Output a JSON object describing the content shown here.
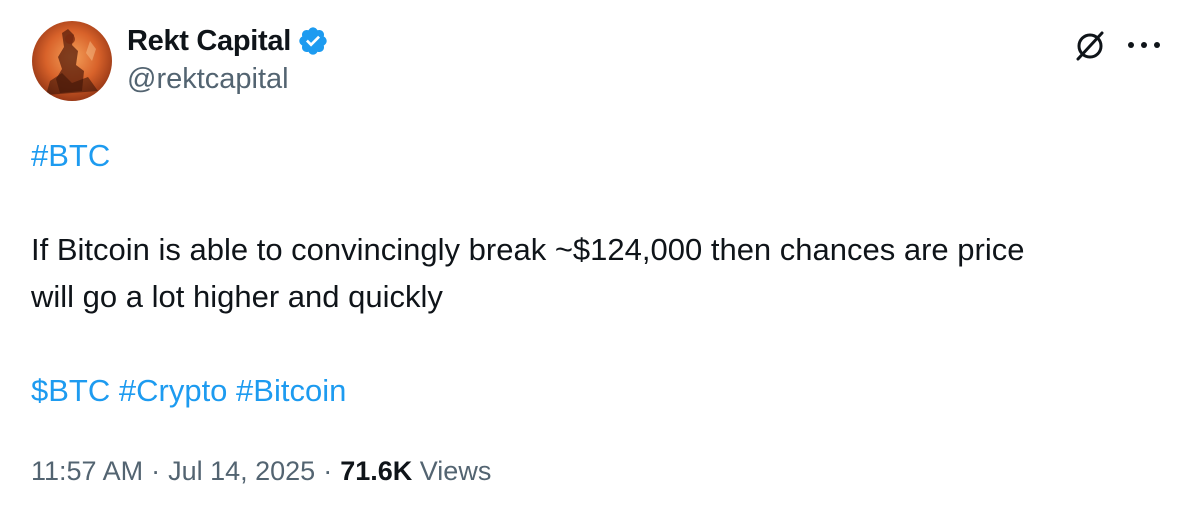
{
  "author": {
    "display_name": "Rekt Capital",
    "handle": "@rektcapital",
    "verified": true,
    "avatar": "avatar-image",
    "verified_badge_color": "#1d9bf0"
  },
  "actions": {
    "grok_icon": "grok-slash-circle-icon",
    "more_icon": "more-horizontal-icon"
  },
  "body": {
    "hashtag_top": "#BTC",
    "line1": "If Bitcoin is able to convincingly break ~$124,000 then chances are price",
    "line2": "will go a lot higher and quickly",
    "tags": [
      "$BTC",
      "#Crypto",
      "#Bitcoin"
    ]
  },
  "meta": {
    "time": "11:57 AM",
    "date": "Jul 14, 2025",
    "separator": "·",
    "views_count": "71.6K",
    "views_label": "Views"
  },
  "colors": {
    "link": "#1d9bf0",
    "text": "#0f1419",
    "secondary": "#536471"
  }
}
